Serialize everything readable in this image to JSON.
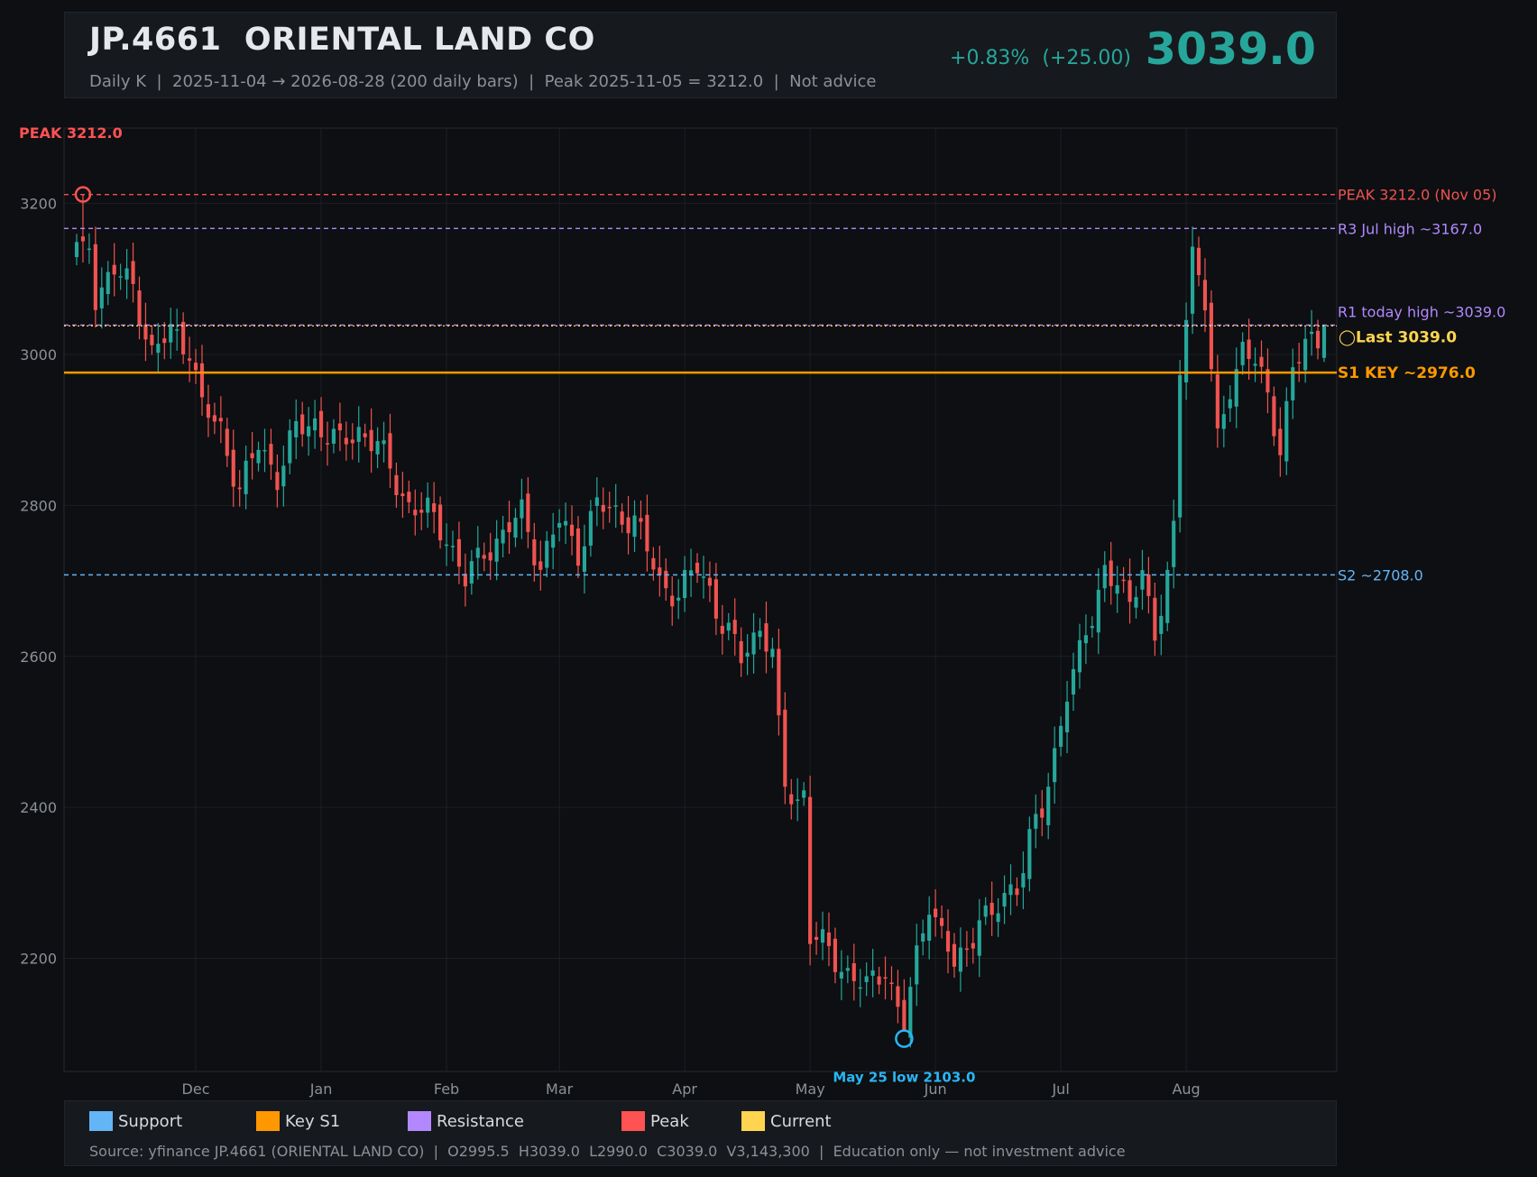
{
  "header": {
    "title": "JP.4661  ORIENTAL LAND CO",
    "subtitle": "Daily K  |  2025-11-04 → 2026-08-28 (200 daily bars)  |  Peak 2025-11-05 = 3212.0  |  Not advice",
    "change": "+0.83%  (+25.00)",
    "last": "3039.0"
  },
  "colors": {
    "up": "#26a69a",
    "down": "#ef5350",
    "peak": "#ff5252",
    "support": "#64b5f6",
    "key_s1": "#ff9800",
    "resistance": "#b388ff",
    "current": "#ffd54f",
    "low_marker": "#29b6f6"
  },
  "chart_data": {
    "type": "candlestick",
    "ylim": [
      2050,
      3300
    ],
    "yticks": [
      2200,
      2400,
      2600,
      2800,
      3000,
      3200
    ],
    "xticks": [
      {
        "label": "Dec",
        "index": 19
      },
      {
        "label": "Jan",
        "index": 39
      },
      {
        "label": "Feb",
        "index": 59
      },
      {
        "label": "Mar",
        "index": 77
      },
      {
        "label": "Apr",
        "index": 97
      },
      {
        "label": "May",
        "index": 117
      },
      {
        "label": "Jun",
        "index": 137
      },
      {
        "label": "Jul",
        "index": 157
      },
      {
        "label": "Aug",
        "index": 177
      }
    ],
    "levels": [
      {
        "label": "PEAK 3212.0 (Nov 05)",
        "value": 3212.0,
        "color": "#ef5350",
        "style": "dashed"
      },
      {
        "label": "R3 Jul high ~3167.0",
        "value": 3167.0,
        "color": "#b388ff",
        "style": "dashed"
      },
      {
        "label": "R1 today high ~3039.0",
        "value": 3039.0,
        "color": "#b388ff",
        "style": "dashed"
      },
      {
        "label": "S1 KEY ~2976.0",
        "value": 2976.0,
        "color": "#ff9800",
        "style": "solid"
      },
      {
        "label": "S2 ~2708.0",
        "value": 2708.0,
        "color": "#64b5f6",
        "style": "dashed"
      }
    ],
    "annotations": {
      "peak_label": "PEAK 3212.0",
      "peak_value": 3212.0,
      "peak_index": 1,
      "low_label": "May 25 low 2103.0",
      "low_value": 2103.0,
      "low_index": 132,
      "last_label": "◯Last 3039.0",
      "last_value": 3039.0
    },
    "anchors": [
      [
        0,
        3140
      ],
      [
        1,
        3212
      ],
      [
        3,
        3080
      ],
      [
        6,
        3110
      ],
      [
        9,
        3090
      ],
      [
        12,
        3000
      ],
      [
        15,
        3030
      ],
      [
        18,
        3010
      ],
      [
        20,
        2930
      ],
      [
        23,
        2900
      ],
      [
        26,
        2820
      ],
      [
        29,
        2880
      ],
      [
        32,
        2840
      ],
      [
        35,
        2900
      ],
      [
        38,
        2910
      ],
      [
        42,
        2880
      ],
      [
        45,
        2900
      ],
      [
        48,
        2880
      ],
      [
        51,
        2830
      ],
      [
        53,
        2800
      ],
      [
        56,
        2790
      ],
      [
        59,
        2760
      ],
      [
        62,
        2700
      ],
      [
        65,
        2740
      ],
      [
        68,
        2760
      ],
      [
        71,
        2790
      ],
      [
        74,
        2720
      ],
      [
        77,
        2780
      ],
      [
        80,
        2740
      ],
      [
        83,
        2800
      ],
      [
        86,
        2790
      ],
      [
        89,
        2780
      ],
      [
        91,
        2740
      ],
      [
        93,
        2700
      ],
      [
        96,
        2680
      ],
      [
        99,
        2720
      ],
      [
        101,
        2690
      ],
      [
        103,
        2640
      ],
      [
        106,
        2600
      ],
      [
        109,
        2640
      ],
      [
        111,
        2600
      ],
      [
        112,
        2500
      ],
      [
        113,
        2430
      ],
      [
        115,
        2410
      ],
      [
        116,
        2420
      ],
      [
        117,
        2230
      ],
      [
        120,
        2210
      ],
      [
        123,
        2180
      ],
      [
        126,
        2160
      ],
      [
        129,
        2190
      ],
      [
        131,
        2130
      ],
      [
        132,
        2110
      ],
      [
        134,
        2200
      ],
      [
        136,
        2280
      ],
      [
        138,
        2230
      ],
      [
        140,
        2190
      ],
      [
        142,
        2210
      ],
      [
        144,
        2260
      ],
      [
        146,
        2250
      ],
      [
        148,
        2280
      ],
      [
        150,
        2300
      ],
      [
        152,
        2360
      ],
      [
        154,
        2390
      ],
      [
        156,
        2470
      ],
      [
        158,
        2560
      ],
      [
        160,
        2600
      ],
      [
        162,
        2650
      ],
      [
        164,
        2720
      ],
      [
        166,
        2700
      ],
      [
        168,
        2660
      ],
      [
        170,
        2720
      ],
      [
        172,
        2630
      ],
      [
        174,
        2700
      ],
      [
        175,
        2760
      ],
      [
        176,
        2980
      ],
      [
        178,
        3140
      ],
      [
        180,
        3070
      ],
      [
        182,
        2880
      ],
      [
        184,
        2960
      ],
      [
        186,
        3010
      ],
      [
        188,
        2990
      ],
      [
        190,
        2940
      ],
      [
        192,
        2880
      ],
      [
        194,
        2980
      ],
      [
        196,
        3010
      ],
      [
        198,
        3020
      ],
      [
        199,
        3039
      ]
    ],
    "bars": 200,
    "last_bar": {
      "open": 2995.5,
      "high": 3039.0,
      "low": 2990.0,
      "close": 3039.0
    }
  },
  "legend": {
    "items": [
      {
        "label": "Support",
        "color": "#64b5f6"
      },
      {
        "label": "Key S1",
        "color": "#ff9800"
      },
      {
        "label": "Resistance",
        "color": "#b388ff"
      },
      {
        "label": "Peak",
        "color": "#ff5252"
      },
      {
        "label": "Current",
        "color": "#ffd54f"
      }
    ],
    "source": "Source: yfinance JP.4661 (ORIENTAL LAND CO)  |  O2995.5  H3039.0  L2990.0  C3039.0  V3,143,300  |  Education only — not investment advice"
  }
}
